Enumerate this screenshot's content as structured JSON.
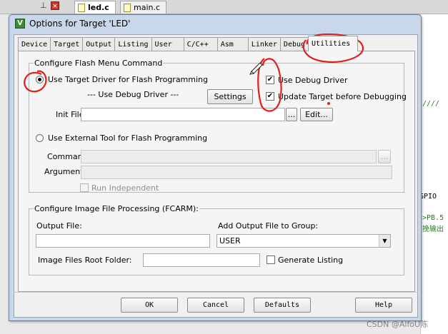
{
  "ide": {
    "tabs": [
      {
        "label": "led.c",
        "icon": "c-file-icon"
      },
      {
        "label": "main.c",
        "icon": "c-file-icon"
      }
    ],
    "code_fragments": [
      "////",
      "GPIO",
      ">PB.5",
      "挽输出"
    ],
    "watermark": "CSDN @AlfoU陈"
  },
  "dialog": {
    "title": "Options for Target 'LED'",
    "tabs": [
      "Device",
      "Target",
      "Output",
      "Listing",
      "User",
      "C/C++",
      "Asm",
      "Linker",
      "Debug",
      "Utilities"
    ],
    "active_tab": "Utilities",
    "flash_group": {
      "legend": "Configure Flash Menu Command",
      "use_target_driver": "Use Target Driver for Flash Programming",
      "use_debug_driver_label": "--- Use Debug Driver ---",
      "settings_button": "Settings",
      "use_debug_driver_check": "Use Debug Driver",
      "update_target_check": "Update Target before Debugging",
      "init_file_label": "Init File:",
      "init_file_value": "",
      "browse_label": "...",
      "edit_button": "Edit...",
      "use_external_tool": "Use External Tool for Flash Programming",
      "command_label": "Command:",
      "arguments_label": "Arguments:",
      "run_independent": "Run Independent"
    },
    "image_group": {
      "legend": "Configure Image File Processing (FCARM):",
      "output_file_label": "Output File:",
      "output_file_value": "",
      "add_output_label": "Add Output File  to Group:",
      "group_value": "USER",
      "root_folder_label": "Image Files Root Folder:",
      "root_folder_value": "",
      "generate_listing": "Generate Listing"
    },
    "buttons": {
      "ok": "OK",
      "cancel": "Cancel",
      "defaults": "Defaults",
      "help": "Help"
    }
  },
  "colors": {
    "annotation": "#e02020",
    "titlebar": "#c8d8ea"
  }
}
